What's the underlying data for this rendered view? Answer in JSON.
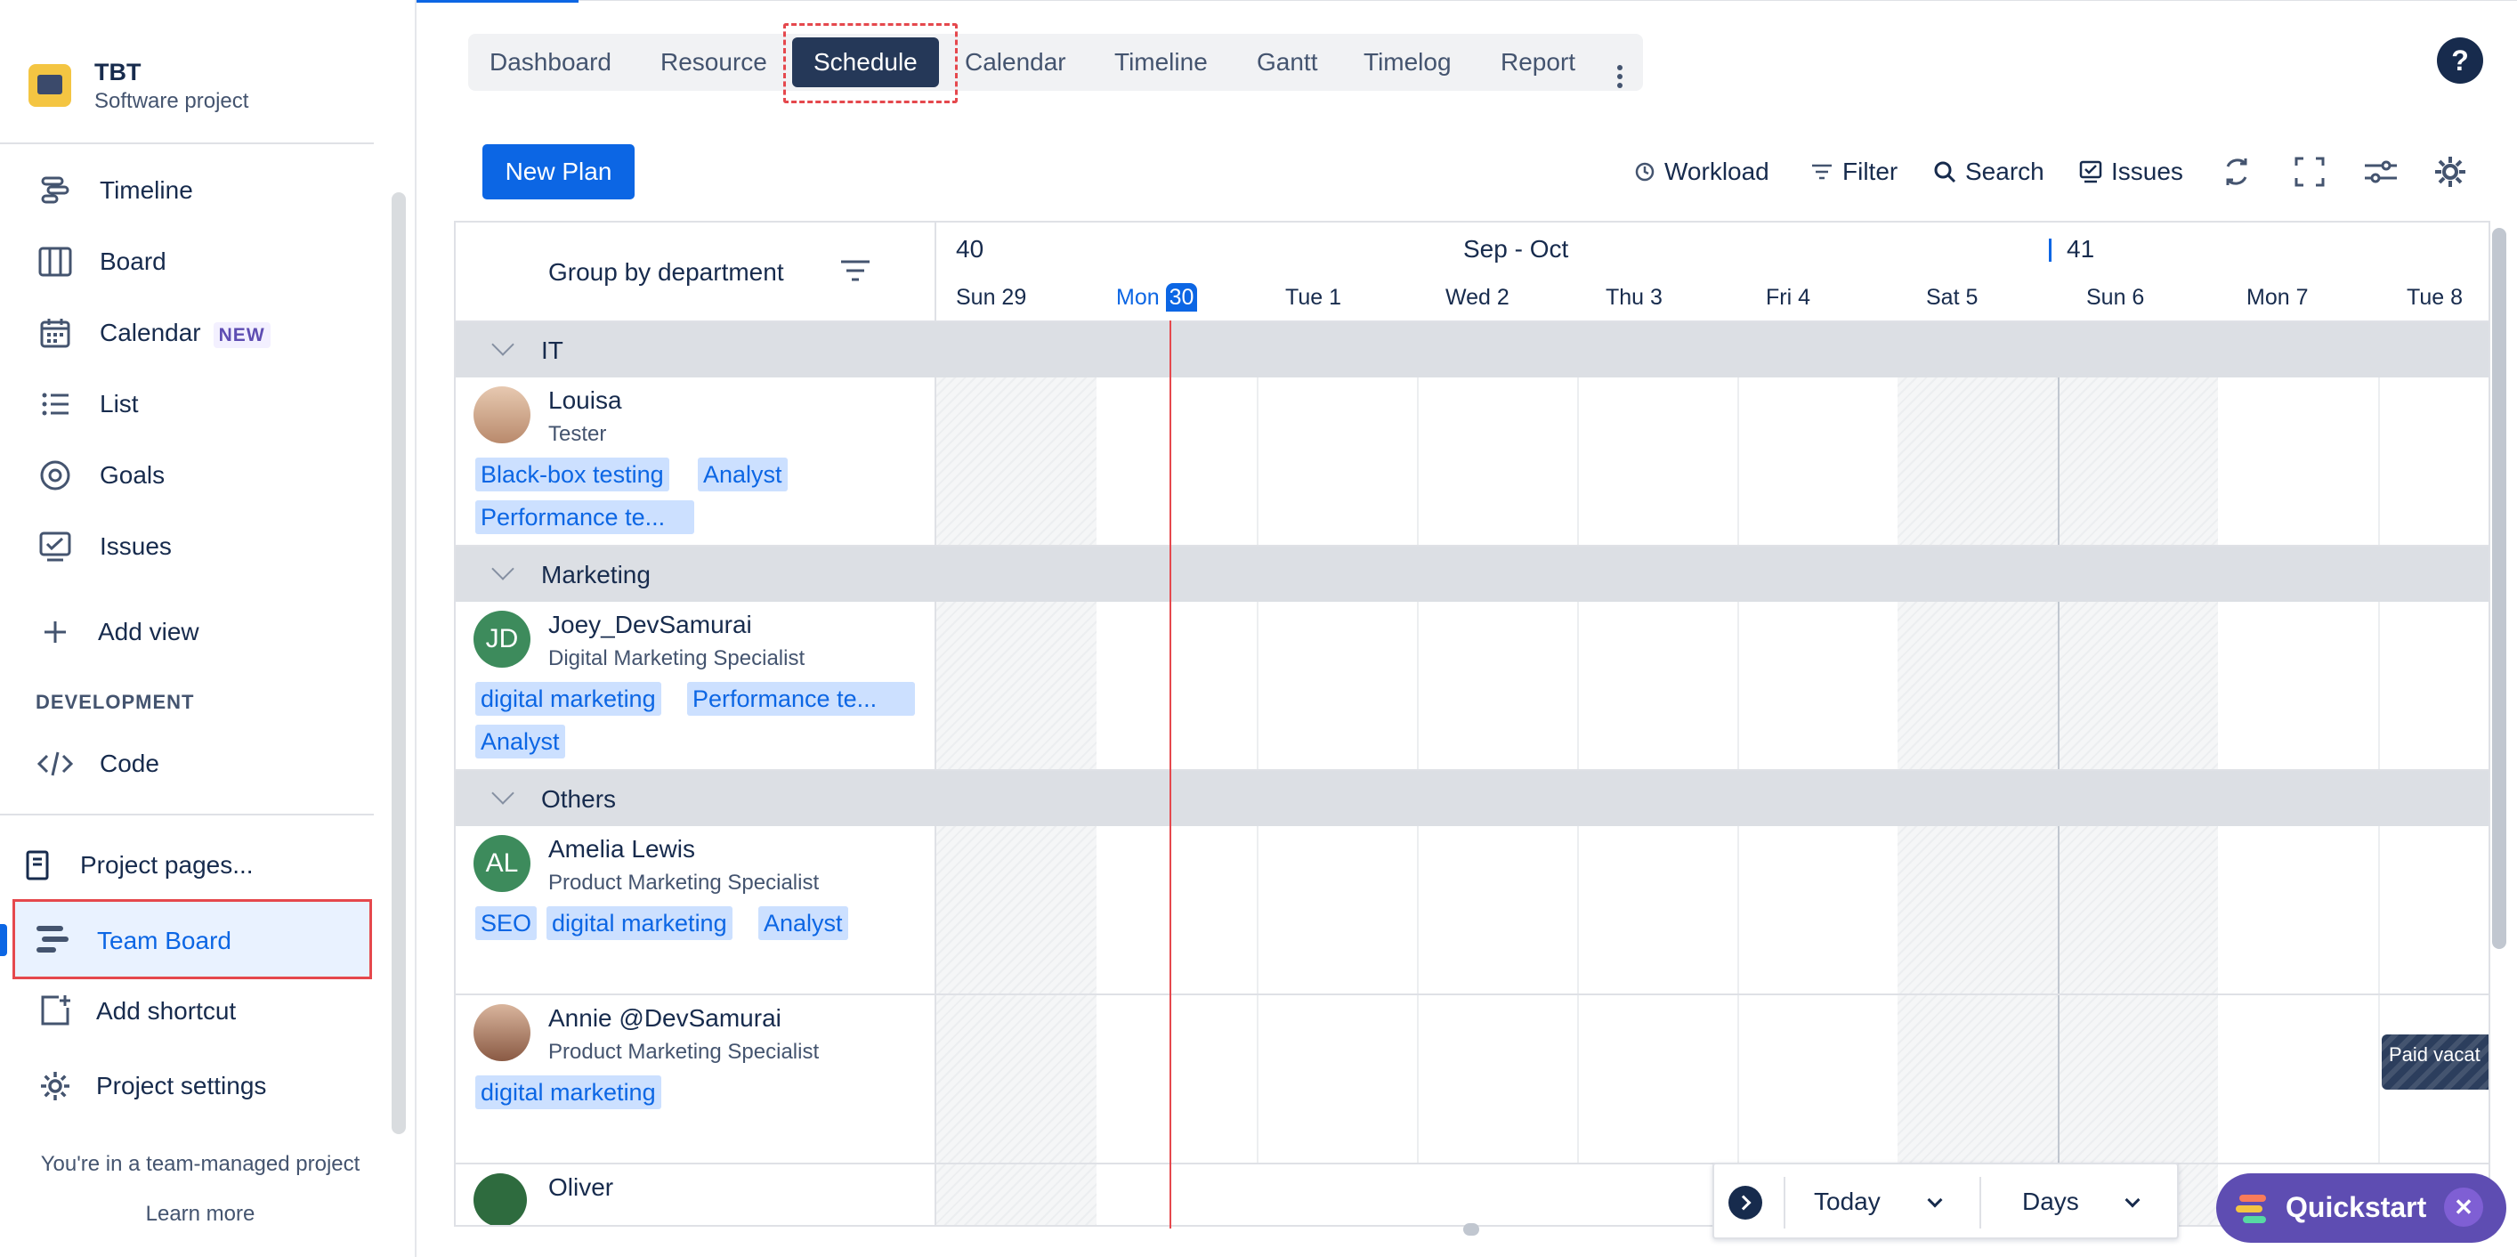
{
  "project": {
    "name": "TBT",
    "type": "Software project"
  },
  "sidebar": {
    "items": [
      {
        "label": "Timeline",
        "icon": "timeline-icon"
      },
      {
        "label": "Board",
        "icon": "board-icon"
      },
      {
        "label": "Calendar",
        "icon": "calendar-icon",
        "badge": "NEW"
      },
      {
        "label": "List",
        "icon": "list-icon"
      },
      {
        "label": "Goals",
        "icon": "goals-icon"
      },
      {
        "label": "Issues",
        "icon": "issues-icon"
      }
    ],
    "add_view": "Add view",
    "section_development": "DEVELOPMENT",
    "code": "Code",
    "project_pages": "Project pages...",
    "team_board": "Team Board",
    "add_shortcut": "Add shortcut",
    "project_settings": "Project settings",
    "footer_text": "You're in a team-managed project",
    "learn_more": "Learn more"
  },
  "tabs": [
    "Dashboard",
    "Resource",
    "Schedule",
    "Calendar",
    "Timeline",
    "Gantt",
    "Timelog",
    "Report"
  ],
  "active_tab": "Schedule",
  "toolbar": {
    "new_plan": "New Plan",
    "workload": "Workload",
    "filter": "Filter",
    "search": "Search",
    "issues": "Issues"
  },
  "grid": {
    "group_by": "Group by department",
    "week_a": "40",
    "week_b": "41",
    "month_range": "Sep - Oct",
    "days": [
      "Sun 29",
      "Mon",
      "Tue 1",
      "Wed 2",
      "Thu 3",
      "Fri 4",
      "Sat 5",
      "Sun 6",
      "Mon 7",
      "Tue 8"
    ],
    "today_number": "30"
  },
  "groups": [
    {
      "name": "IT",
      "people": [
        {
          "name": "Louisa",
          "role": "Tester",
          "initials": "",
          "skills": [
            "Black-box testing",
            "Analyst",
            "Performance te..."
          ]
        }
      ]
    },
    {
      "name": "Marketing",
      "people": [
        {
          "name": "Joey_DevSamurai",
          "role": "Digital Marketing Specialist",
          "initials": "JD",
          "skills": [
            "digital marketing",
            "Performance te...",
            "Analyst"
          ]
        }
      ]
    },
    {
      "name": "Others",
      "people": [
        {
          "name": "Amelia Lewis",
          "role": "Product Marketing Specialist",
          "initials": "AL",
          "skills": [
            "SEO",
            "digital marketing",
            "Analyst"
          ]
        },
        {
          "name": "Annie @DevSamurai",
          "role": "Product Marketing Specialist",
          "initials": "",
          "skills": [
            "digital marketing"
          ]
        },
        {
          "name": "Oliver",
          "role": "",
          "initials": "",
          "skills": []
        }
      ]
    }
  ],
  "events": {
    "paid_vacation": "Paid vacat"
  },
  "bottom": {
    "today": "Today",
    "days": "Days"
  },
  "quickstart": "Quickstart",
  "colors": {
    "primary": "#0c66e4",
    "active_tab": "#253858",
    "now_line": "#e5484d",
    "quickstart": "#5e4db2"
  }
}
